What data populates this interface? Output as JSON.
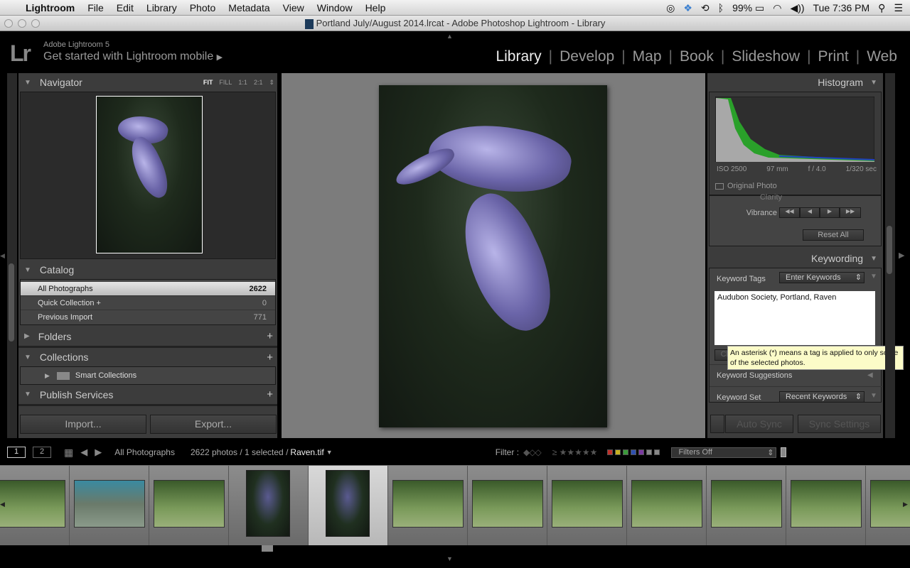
{
  "menubar": {
    "app": "Lightroom",
    "items": [
      "File",
      "Edit",
      "Library",
      "Photo",
      "Metadata",
      "View",
      "Window",
      "Help"
    ],
    "battery": "99%",
    "clock": "Tue 7:36 PM"
  },
  "window": {
    "title": "Portland July/August 2014.lrcat - Adobe Photoshop Lightroom - Library"
  },
  "identity": {
    "logo": "Lr",
    "product": "Adobe Lightroom 5",
    "tagline": "Get started with Lightroom mobile",
    "modules": [
      "Library",
      "Develop",
      "Map",
      "Book",
      "Slideshow",
      "Print",
      "Web"
    ],
    "active_module": "Library"
  },
  "left": {
    "navigator": {
      "title": "Navigator",
      "zooms": [
        "FIT",
        "FILL",
        "1:1",
        "2:1"
      ],
      "active_zoom": "FIT"
    },
    "catalog": {
      "title": "Catalog",
      "items": [
        {
          "label": "All Photographs",
          "count": "2622"
        },
        {
          "label": "Quick Collection +",
          "count": "0"
        },
        {
          "label": "Previous Import",
          "count": "771"
        }
      ]
    },
    "folders": {
      "title": "Folders"
    },
    "collections": {
      "title": "Collections",
      "items": [
        "Smart Collections"
      ]
    },
    "publish": {
      "title": "Publish Services"
    },
    "import_label": "Import...",
    "export_label": "Export..."
  },
  "right": {
    "histogram": {
      "title": "Histogram",
      "iso": "ISO 2500",
      "focal": "97 mm",
      "aperture": "f / 4.0",
      "shutter": "1/320 sec",
      "original_photo": "Original Photo"
    },
    "quick_develop": {
      "clarity": "Clarity",
      "vibrance": "Vibrance",
      "reset": "Reset All"
    },
    "keywording": {
      "title": "Keywording",
      "tags_label": "Keyword Tags",
      "tags_mode": "Enter Keywords",
      "keywords": "Audubon Society, Portland, Raven",
      "click_hint": "Cli",
      "tooltip": "An asterisk (*) means a tag is applied to only some of the selected photos.",
      "suggestions": "Keyword Suggestions",
      "set_label": "Keyword Set",
      "set_value": "Recent Keywords"
    },
    "auto_sync": "Auto Sync",
    "sync_settings": "Sync Settings"
  },
  "filmstrip": {
    "page1": "1",
    "page2": "2",
    "source": "All Photographs",
    "count": "2622 photos / 1 selected /",
    "filename": "Raven.tif",
    "filter_label": "Filter :",
    "filters_value": "Filters Off",
    "label_colors": [
      "#c0302a",
      "#c8b020",
      "#3a9a3a",
      "#3050b0",
      "#7a3aa0",
      "#888888",
      "#888888"
    ]
  }
}
